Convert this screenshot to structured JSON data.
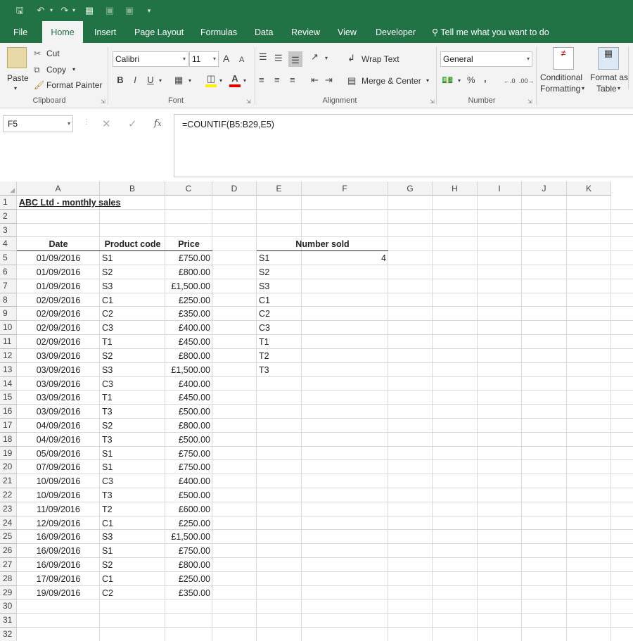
{
  "tabs": [
    "File",
    "Home",
    "Insert",
    "Page Layout",
    "Formulas",
    "Data",
    "Review",
    "View",
    "Developer"
  ],
  "tell_me": "Tell me what you want to do",
  "clipboard": {
    "paste": "Paste",
    "cut": "Cut",
    "copy": "Copy",
    "format_painter": "Format Painter",
    "group": "Clipboard"
  },
  "font": {
    "name": "Calibri",
    "size": "11",
    "bold": "B",
    "italic": "I",
    "underline": "U",
    "grow": "A",
    "shrink": "A",
    "group": "Font"
  },
  "alignment": {
    "wrap_text": "Wrap Text",
    "merge_center": "Merge & Center",
    "group": "Alignment"
  },
  "number": {
    "format": "General",
    "percent": "%",
    "comma": ",",
    "group": "Number"
  },
  "styles": {
    "conditional_1": "Conditional",
    "conditional_2": "Formatting",
    "format_table_1": "Format as",
    "format_table_2": "Table"
  },
  "name_box": "F5",
  "formula": "=COUNTIF(B5:B29,E5)",
  "columns": [
    "A",
    "B",
    "C",
    "D",
    "E",
    "F",
    "G",
    "H",
    "I",
    "J",
    "K"
  ],
  "rows": [
    "1",
    "2",
    "3",
    "4",
    "5",
    "6",
    "7",
    "8",
    "9",
    "10",
    "11",
    "12",
    "13",
    "14",
    "15",
    "16",
    "17",
    "18",
    "19",
    "20",
    "21",
    "22",
    "23",
    "24",
    "25",
    "26",
    "27",
    "28",
    "29",
    "30",
    "31",
    "32"
  ],
  "sheet": {
    "title": "ABC Ltd - monthly sales",
    "headers": {
      "date": "Date",
      "product_code": "Product code",
      "price": "Price",
      "number_sold": "Number sold"
    },
    "sales": [
      [
        "01/09/2016",
        "S1",
        "£750.00"
      ],
      [
        "01/09/2016",
        "S2",
        "£800.00"
      ],
      [
        "01/09/2016",
        "S3",
        "£1,500.00"
      ],
      [
        "02/09/2016",
        "C1",
        "£250.00"
      ],
      [
        "02/09/2016",
        "C2",
        "£350.00"
      ],
      [
        "02/09/2016",
        "C3",
        "£400.00"
      ],
      [
        "02/09/2016",
        "T1",
        "£450.00"
      ],
      [
        "03/09/2016",
        "S2",
        "£800.00"
      ],
      [
        "03/09/2016",
        "S3",
        "£1,500.00"
      ],
      [
        "03/09/2016",
        "C3",
        "£400.00"
      ],
      [
        "03/09/2016",
        "T1",
        "£450.00"
      ],
      [
        "03/09/2016",
        "T3",
        "£500.00"
      ],
      [
        "04/09/2016",
        "S2",
        "£800.00"
      ],
      [
        "04/09/2016",
        "T3",
        "£500.00"
      ],
      [
        "05/09/2016",
        "S1",
        "£750.00"
      ],
      [
        "07/09/2016",
        "S1",
        "£750.00"
      ],
      [
        "10/09/2016",
        "C3",
        "£400.00"
      ],
      [
        "10/09/2016",
        "T3",
        "£500.00"
      ],
      [
        "11/09/2016",
        "T2",
        "£600.00"
      ],
      [
        "12/09/2016",
        "C1",
        "£250.00"
      ],
      [
        "16/09/2016",
        "S3",
        "£1,500.00"
      ],
      [
        "16/09/2016",
        "S1",
        "£750.00"
      ],
      [
        "16/09/2016",
        "S2",
        "£800.00"
      ],
      [
        "17/09/2016",
        "C1",
        "£250.00"
      ],
      [
        "19/09/2016",
        "C2",
        "£350.00"
      ]
    ],
    "product_list": [
      "S1",
      "S2",
      "S3",
      "C1",
      "C2",
      "C3",
      "T1",
      "T2",
      "T3"
    ],
    "number_sold_first": "4"
  },
  "accent": "#217346"
}
